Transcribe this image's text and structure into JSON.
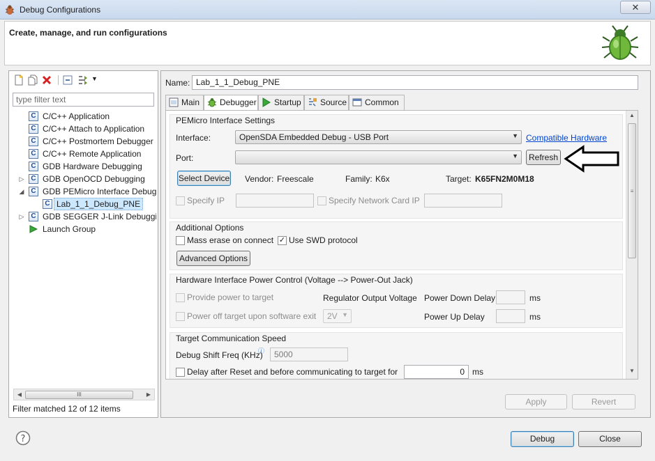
{
  "window": {
    "title": "Debug Configurations",
    "close_glyph": "✕",
    "header_text": "Create, manage, and run configurations"
  },
  "left": {
    "filter_placeholder": "type filter text",
    "tree": [
      {
        "label": "C/C++ Application",
        "icon": "c-icon"
      },
      {
        "label": "C/C++ Attach to Application",
        "icon": "c-icon"
      },
      {
        "label": "C/C++ Postmortem Debugger",
        "icon": "c-icon"
      },
      {
        "label": "C/C++ Remote Application",
        "icon": "c-icon"
      },
      {
        "label": "GDB Hardware Debugging",
        "icon": "c-icon"
      },
      {
        "label": "GDB OpenOCD Debugging",
        "icon": "c-icon"
      },
      {
        "label": "GDB PEMicro Interface Debugg",
        "icon": "c-icon"
      },
      {
        "label": "Lab_1_1_Debug_PNE",
        "icon": "c-icon"
      },
      {
        "label": "GDB SEGGER J-Link Debugging",
        "icon": "c-icon"
      },
      {
        "label": "Launch Group",
        "icon": "launch-icon"
      }
    ],
    "scroll_grip": "III",
    "filter_status": "Filter matched 12 of 12 items"
  },
  "right": {
    "name_label": "Name:",
    "name_value": "Lab_1_1_Debug_PNE",
    "tabs": [
      {
        "label": "Main"
      },
      {
        "label": "Debugger"
      },
      {
        "label": "Startup"
      },
      {
        "label": "Source"
      },
      {
        "label": "Common"
      }
    ],
    "pemicro": {
      "title": "PEMicro Interface Settings",
      "interface_label": "Interface:",
      "interface_value": "OpenSDA Embedded Debug - USB Port",
      "compatible_link": "Compatible Hardware",
      "port_label": "Port:",
      "port_value": "",
      "refresh": "Refresh",
      "select_device": "Select Device",
      "vendor_label": "Vendor:",
      "vendor_value": "Freescale",
      "family_label": "Family:",
      "family_value": "K6x",
      "target_label": "Target:",
      "target_value": "K65FN2M0M18",
      "specify_ip": "Specify IP",
      "specify_network": "Specify Network Card IP"
    },
    "additional": {
      "title": "Additional Options",
      "mass_erase": "Mass erase on connect",
      "use_swd": "Use SWD protocol",
      "advanced": "Advanced Options",
      "check_mark": "✓"
    },
    "power": {
      "title": "Hardware Interface Power Control (Voltage --> Power-Out Jack)",
      "provide_power": "Provide power to target",
      "regulator_label": "Regulator Output Voltage",
      "power_down_label": "Power Down Delay",
      "power_down_unit": "ms",
      "power_off": "Power off target upon software exit",
      "voltage_value": "2V",
      "power_up_label": "Power Up Delay",
      "power_up_unit": "ms"
    },
    "comm": {
      "title": "Target Communication Speed",
      "shift_freq_label": "Debug Shift Freq (KHz)",
      "shift_freq_value": "5000",
      "delay_label": "Delay after Reset and before communicating to target for",
      "delay_value": "0",
      "delay_unit": "ms"
    },
    "apply": "Apply",
    "revert": "Revert"
  },
  "footer": {
    "debug": "Debug",
    "close": "Close"
  }
}
